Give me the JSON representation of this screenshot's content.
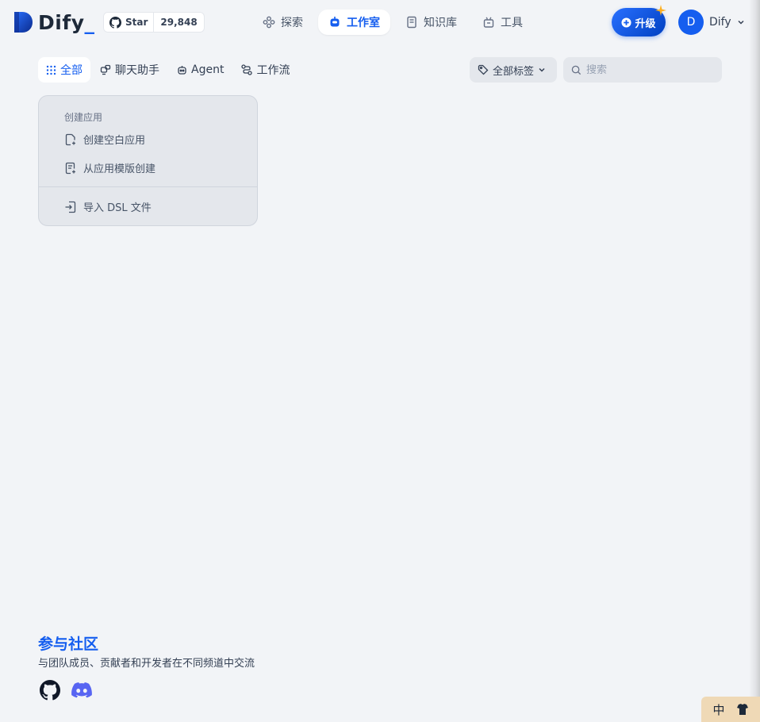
{
  "app": {
    "logo_text": "Dify",
    "logo_suffix": "_"
  },
  "github": {
    "star_label": "Star",
    "star_count": "29,848"
  },
  "nav": {
    "items": [
      {
        "label": "探索",
        "icon": "explore-icon",
        "active": false
      },
      {
        "label": "工作室",
        "icon": "robot-icon",
        "active": true
      },
      {
        "label": "知识库",
        "icon": "book-icon",
        "active": false
      },
      {
        "label": "工具",
        "icon": "toolbox-icon",
        "active": false
      }
    ]
  },
  "upgrade": {
    "label": "升级"
  },
  "user": {
    "avatar_initial": "D",
    "name": "Dify"
  },
  "filters": {
    "tabs": [
      {
        "label": "全部",
        "icon": "grid-icon",
        "active": true
      },
      {
        "label": "聊天助手",
        "icon": "chat-bot-icon",
        "active": false
      },
      {
        "label": "Agent",
        "icon": "agent-icon",
        "active": false
      },
      {
        "label": "工作流",
        "icon": "workflow-icon",
        "active": false
      }
    ],
    "tag_label": "全部标签",
    "search_placeholder": "搜索"
  },
  "create_card": {
    "title": "创建应用",
    "blank_label": "创建空白应用",
    "template_label": "从应用模版创建",
    "import_label": "导入 DSL 文件"
  },
  "community": {
    "title": "参与社区",
    "description": "与团队成员、贡献者和开发者在不同频道中交流"
  },
  "ime": {
    "mode": "中"
  },
  "colors": {
    "accent": "#155eef",
    "background": "#f2f4f7",
    "discord": "#5865f2"
  }
}
